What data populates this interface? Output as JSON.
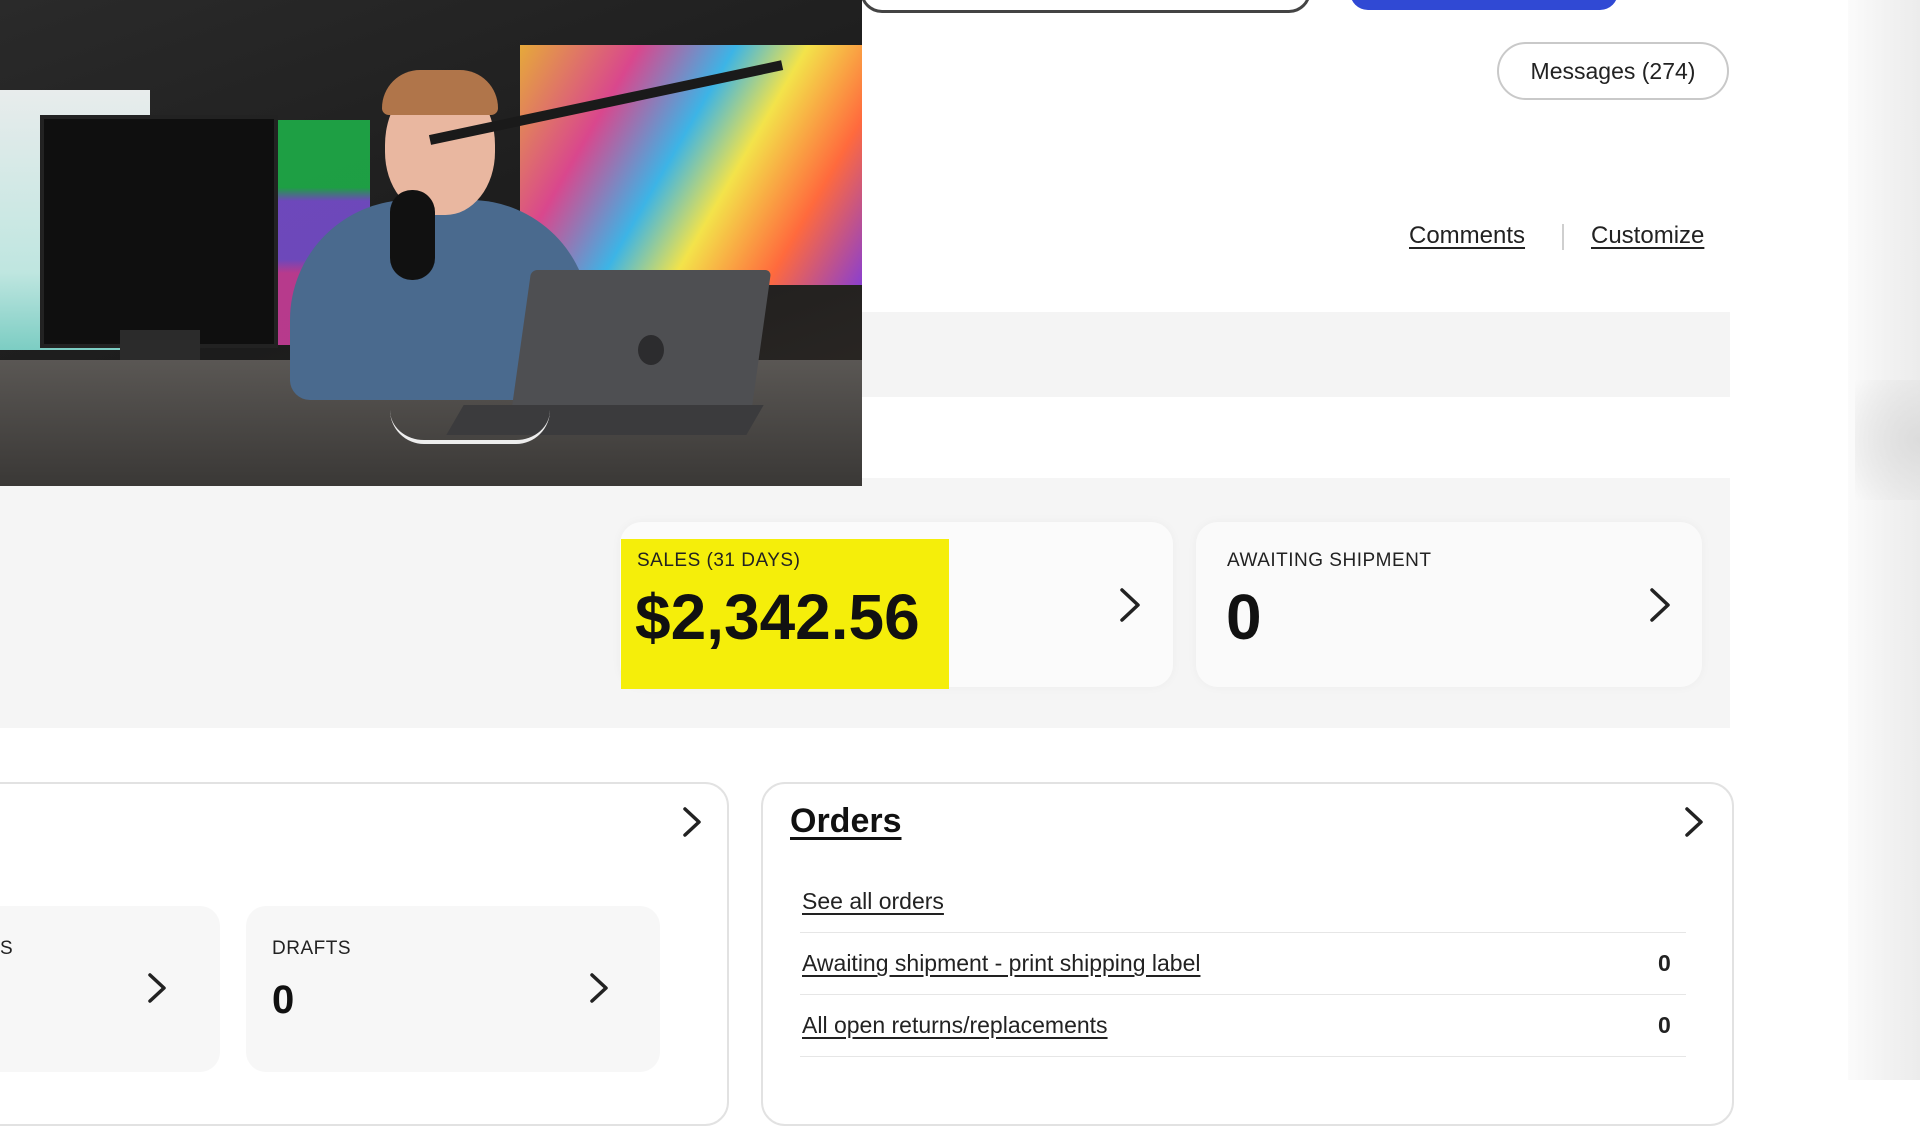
{
  "header": {
    "messages_label": "Messages (274)",
    "comments_label": "Comments",
    "customize_label": "Customize"
  },
  "summary": {
    "sales": {
      "label": "SALES (31 DAYS)",
      "value": "$2,342.56",
      "highlight_color": "#f5ee0a"
    },
    "awaiting": {
      "label": "AWAITING SHIPMENT",
      "value": "0"
    }
  },
  "listings": {
    "active_label_stub": "S",
    "drafts": {
      "label": "DRAFTS",
      "value": "0"
    }
  },
  "orders": {
    "title": "Orders",
    "see_all": "See all orders",
    "rows": [
      {
        "label": "Awaiting shipment - print shipping label",
        "count": "0"
      },
      {
        "label": "All open returns/replacements",
        "count": "0"
      }
    ]
  },
  "colors": {
    "primary_button": "#3049d4"
  },
  "icons": {
    "chevron": "chevron-right-icon"
  }
}
